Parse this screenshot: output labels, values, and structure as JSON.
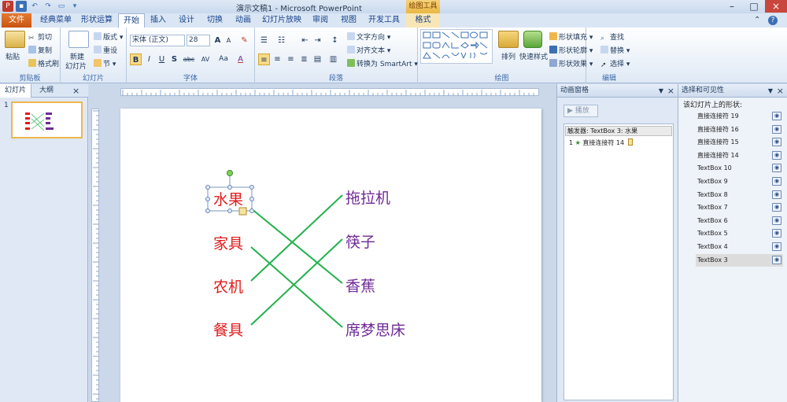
{
  "window": {
    "title": "演示文稿1 - Microsoft PowerPoint",
    "context_tool": "绘图工具",
    "help": "?"
  },
  "tabs": {
    "file": "文件",
    "items": [
      "经典菜单",
      "形状运算",
      "开始",
      "插入",
      "设计",
      "切换",
      "动画",
      "幻灯片放映",
      "审阅",
      "视图",
      "开发工具",
      "格式"
    ],
    "active": "开始"
  },
  "ribbon": {
    "clipboard": {
      "label": "剪贴板",
      "paste": "粘贴",
      "cut": "剪切",
      "copy": "复制",
      "format_painter": "格式刷"
    },
    "slides": {
      "label": "幻灯片",
      "new_slide": "新建\n幻灯片",
      "new_slide_line1": "新建",
      "new_slide_line2": "幻灯片",
      "layout": "版式",
      "reset": "重设",
      "section": "节"
    },
    "font": {
      "label": "字体",
      "font_name": "宋体 (正文)",
      "font_size": "28",
      "grow": "A",
      "shrink": "A",
      "bold": "B",
      "italic": "I",
      "underline": "U",
      "strike": "S",
      "strike_abc": "abc",
      "spacing": "AV",
      "case": "Aa",
      "color": "A"
    },
    "paragraph": {
      "label": "段落",
      "text_direction": "文字方向",
      "align_text": "对齐文本",
      "smartart": "转换为 SmartArt"
    },
    "drawing": {
      "label": "绘图",
      "arrange": "排列",
      "quick_styles": "快速样式",
      "shape_fill": "形状填充",
      "shape_outline": "形状轮廓",
      "shape_effects": "形状效果"
    },
    "editing": {
      "label": "编辑",
      "find": "查找",
      "replace": "替换",
      "select": "选择"
    }
  },
  "left_panel": {
    "tabs": [
      "幻灯片",
      "大纲"
    ],
    "close": "×",
    "slide_number": "1"
  },
  "slide": {
    "left_words": [
      "水果",
      "家具",
      "农机",
      "餐具"
    ],
    "right_words": [
      "拖拉机",
      "筷子",
      "香蕉",
      "席梦思床"
    ],
    "line_color": "#22b14c",
    "left_color": "#e21b1b",
    "right_color": "#6f2a96"
  },
  "animation_pane": {
    "title": "动画窗格",
    "play": "播放",
    "trigger": "触发器: TextBox 3: 水果",
    "item_number": "1",
    "item_label": "直接连接符 14"
  },
  "selection_pane": {
    "title": "选择和可见性",
    "subtitle": "该幻灯片上的形状:",
    "shapes": [
      "直接连接符 19",
      "直接连接符 16",
      "直接连接符 15",
      "直接连接符 14",
      "TextBox 10",
      "TextBox 9",
      "TextBox 8",
      "TextBox 7",
      "TextBox 6",
      "TextBox 5",
      "TextBox 4",
      "TextBox 3"
    ],
    "selected": "TextBox 3",
    "eye_icon": "eye-icon"
  }
}
